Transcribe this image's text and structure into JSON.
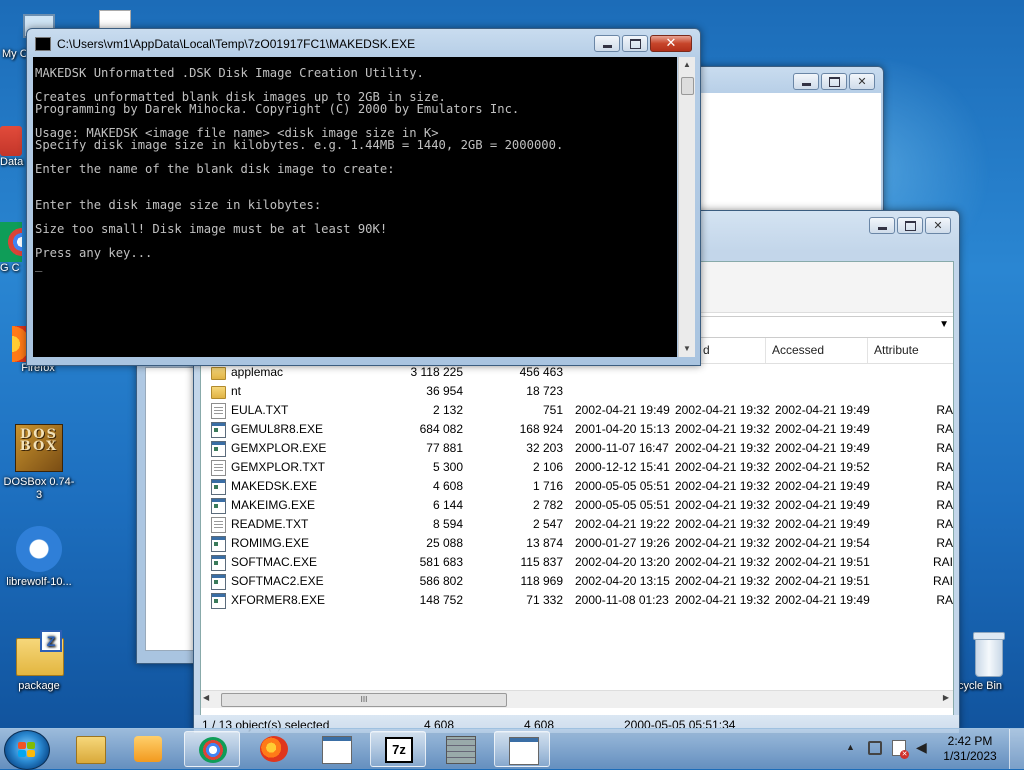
{
  "desktop": {
    "icons": [
      {
        "label": "My C",
        "icon": "computer-icon"
      },
      {
        "label": "Data",
        "icon": "app-icon"
      },
      {
        "label": "G C",
        "icon": "chrome-icon"
      },
      {
        "label": "Firefox",
        "icon": "firefox-icon"
      },
      {
        "label": "DOSBox 0.74-3",
        "icon": "dosbox-icon",
        "glyph": "BOX",
        "glyph2": "DOS"
      },
      {
        "label": "librewolf-10...",
        "icon": "librewolf-icon"
      },
      {
        "label": "package",
        "icon": "package-icon",
        "glyph": "Z"
      },
      {
        "label": "cycle Bin",
        "icon": "recycle-bin-icon"
      }
    ]
  },
  "console": {
    "title": "C:\\Users\\vm1\\AppData\\Local\\Temp\\7zO01917FC1\\MAKEDSK.EXE",
    "lines": [
      "MAKEDSK Unformatted .DSK Disk Image Creation Utility.",
      "",
      "Creates unformatted blank disk images up to 2GB in size.",
      "Programming by Darek Mihocka. Copyright (C) 2000 by Emulators Inc.",
      "",
      "Usage: MAKEDSK <image file name> <disk image size in K>",
      "Specify disk image size in kilobytes. e.g. 1.44MB = 1440, 2GB = 2000000.",
      "",
      "Enter the name of the blank disk image to create:",
      "",
      "",
      "Enter the disk image size in kilobytes:",
      "",
      "Size too small! Disk image must be at least 90K!",
      "",
      "Press any key...",
      "_"
    ]
  },
  "filemanager": {
    "columns": [
      "d",
      "Accessed",
      "Attribute"
    ],
    "rows": [
      {
        "type": "folder",
        "name": "applemac",
        "size": "3 118 225",
        "packed": "456 463",
        "modified": "",
        "created": "",
        "accessed": "",
        "attr": ""
      },
      {
        "type": "folder",
        "name": "nt",
        "size": "36 954",
        "packed": "18 723",
        "modified": "",
        "created": "",
        "accessed": "",
        "attr": ""
      },
      {
        "type": "txt",
        "name": "EULA.TXT",
        "size": "2 132",
        "packed": "751",
        "modified": "2002-04-21 19:49",
        "created": "2002-04-21 19:32",
        "accessed": "2002-04-21 19:49",
        "attr": "RA"
      },
      {
        "type": "exe",
        "name": "GEMUL8R8.EXE",
        "size": "684 082",
        "packed": "168 924",
        "modified": "2001-04-20 15:13",
        "created": "2002-04-21 19:32",
        "accessed": "2002-04-21 19:49",
        "attr": "RA"
      },
      {
        "type": "exe",
        "name": "GEMXPLOR.EXE",
        "size": "77 881",
        "packed": "32 203",
        "modified": "2000-11-07 16:47",
        "created": "2002-04-21 19:32",
        "accessed": "2002-04-21 19:49",
        "attr": "RA"
      },
      {
        "type": "txt",
        "name": "GEMXPLOR.TXT",
        "size": "5 300",
        "packed": "2 106",
        "modified": "2000-12-12 15:41",
        "created": "2002-04-21 19:32",
        "accessed": "2002-04-21 19:52",
        "attr": "RA"
      },
      {
        "type": "exe",
        "name": "MAKEDSK.EXE",
        "size": "4 608",
        "packed": "1 716",
        "modified": "2000-05-05 05:51",
        "created": "2002-04-21 19:32",
        "accessed": "2002-04-21 19:49",
        "attr": "RA",
        "selected": true
      },
      {
        "type": "exe",
        "name": "MAKEIMG.EXE",
        "size": "6 144",
        "packed": "2 782",
        "modified": "2000-05-05 05:51",
        "created": "2002-04-21 19:32",
        "accessed": "2002-04-21 19:49",
        "attr": "RA"
      },
      {
        "type": "txt",
        "name": "README.TXT",
        "size": "8 594",
        "packed": "2 547",
        "modified": "2002-04-21 19:22",
        "created": "2002-04-21 19:32",
        "accessed": "2002-04-21 19:49",
        "attr": "RA"
      },
      {
        "type": "exe",
        "name": "ROMIMG.EXE",
        "size": "25 088",
        "packed": "13 874",
        "modified": "2000-01-27 19:26",
        "created": "2002-04-21 19:32",
        "accessed": "2002-04-21 19:54",
        "attr": "RA"
      },
      {
        "type": "exe",
        "name": "SOFTMAC.EXE",
        "size": "581 683",
        "packed": "115 837",
        "modified": "2002-04-20 13:20",
        "created": "2002-04-21 19:32",
        "accessed": "2002-04-21 19:51",
        "attr": "RAI"
      },
      {
        "type": "exe",
        "name": "SOFTMAC2.EXE",
        "size": "586 802",
        "packed": "118 969",
        "modified": "2002-04-20 13:15",
        "created": "2002-04-21 19:32",
        "accessed": "2002-04-21 19:51",
        "attr": "RAI"
      },
      {
        "type": "exe",
        "name": "XFORMER8.EXE",
        "size": "148 752",
        "packed": "71 332",
        "modified": "2000-11-08 01:23",
        "created": "2002-04-21 19:32",
        "accessed": "2002-04-21 19:49",
        "attr": "RA"
      }
    ],
    "status": {
      "selection": "1 / 13 object(s) selected",
      "size": "4 608",
      "packed": "4 608",
      "modified": "2000-05-05 05:51:34"
    },
    "scroll_glyph": "III"
  },
  "taskbar": {
    "items": [
      {
        "icon": "explorer-icon"
      },
      {
        "icon": "media-player-icon"
      },
      {
        "icon": "chrome-icon",
        "active": true
      },
      {
        "icon": "firefox-icon"
      },
      {
        "icon": "console-icon"
      },
      {
        "icon": "7zip-icon",
        "active": true,
        "glyph": "7z"
      },
      {
        "icon": "firewall-icon"
      },
      {
        "icon": "console-icon",
        "active": true
      }
    ],
    "clock": {
      "time": "2:42 PM",
      "date": "1/31/2023"
    },
    "tray_arrow": "▲"
  },
  "colors": {
    "console_bg": "#000000",
    "console_fg": "#c0c0c0",
    "accent": "#3a6ea5"
  }
}
